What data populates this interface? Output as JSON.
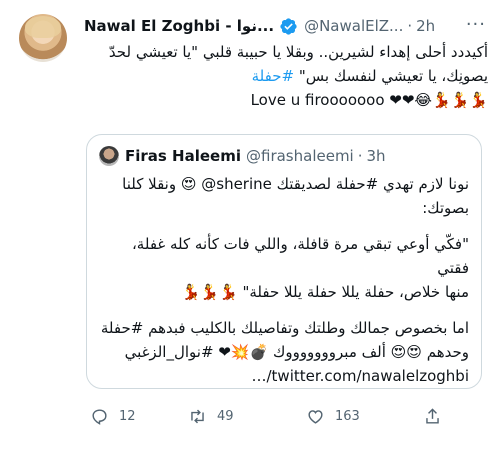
{
  "tweet": {
    "author_name": "Nawal El Zoghbi - نوا...",
    "handle": "@NawalElZ...",
    "separator": "·",
    "time": "2h",
    "text_lines": [
      "أكيددد أحلى إهداء لشيرين.. وبقلا يا حبيبة قلبي \"يا تعيشي لحدّ",
      "يصونِك، يا تعيشي لنفسك بس\"",
      "Love u firooooooo ❤❤😂💃💃💃"
    ],
    "hashtag": "#حفلة",
    "verified": true
  },
  "quote": {
    "author_name": "Firas Haleemi",
    "handle": "@firashaleemi",
    "separator": "·",
    "time": "3h",
    "lines": [
      "نونا لازم تهدي #حفلة لصديقتك sherine@ 😍 ونقلا كلنا",
      "بصوتك:",
      "",
      "\"فكّي أوعي تبقي مرة قافلة، واللي فات كأنه كله غفلة، فقتي",
      "منها خلاص، حفلة يللا حفلة يللا حفلة\" 💃💃💃",
      "",
      "اما بخصوص جمالك وطلتك وتفاصيلك بالكليب فبدهم #حفلة",
      "وحدهم 😍😍 ألف مبروووووووك 💣💥❤ #نوال_الزغبي",
      "…/twitter.com/nawalelzoghbi"
    ]
  },
  "actions": {
    "reply_count": "12",
    "retweet_count": "49",
    "like_count": "163"
  },
  "colors": {
    "link": "#1d9bf0",
    "secondary_text": "#536471",
    "verified": "#1d9bf0",
    "border": "#cfd9de"
  },
  "icons": [
    "verified-icon",
    "more-icon",
    "reply-icon",
    "retweet-icon",
    "like-icon",
    "share-icon"
  ]
}
